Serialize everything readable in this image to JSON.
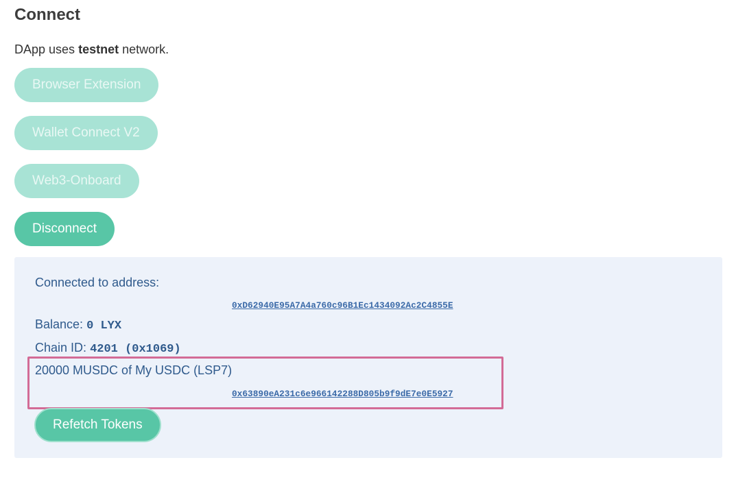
{
  "page": {
    "title": "Connect",
    "network_prefix": "DApp uses",
    "network_name": "testnet",
    "network_suffix": "network."
  },
  "connect_buttons": {
    "browser_extension": "Browser Extension",
    "wallet_connect": "Wallet Connect V2",
    "web3_onboard": "Web3-Onboard",
    "disconnect": "Disconnect"
  },
  "account": {
    "connected_label": "Connected to address:",
    "address": "0xD62940E95A7A4a760c96B1Ec1434092Ac2C4855E",
    "balance_label": "Balance:",
    "balance_value": "0 LYX",
    "chain_label": "Chain ID:",
    "chain_value": "4201 (0x1069)"
  },
  "tokens": {
    "items": [
      {
        "description": "20000 MUSDC of My USDC (LSP7)",
        "address": "0x63890eA231c6e966142288D805b9f9dE7e0E5927"
      }
    ],
    "refetch_label": "Refetch Tokens"
  },
  "colors": {
    "primary": "#58c6a6",
    "disabled": "#a8e3d5",
    "panel_bg": "#edf2fa",
    "highlight_border": "#d36b96",
    "text_blue": "#2f5a8c"
  }
}
